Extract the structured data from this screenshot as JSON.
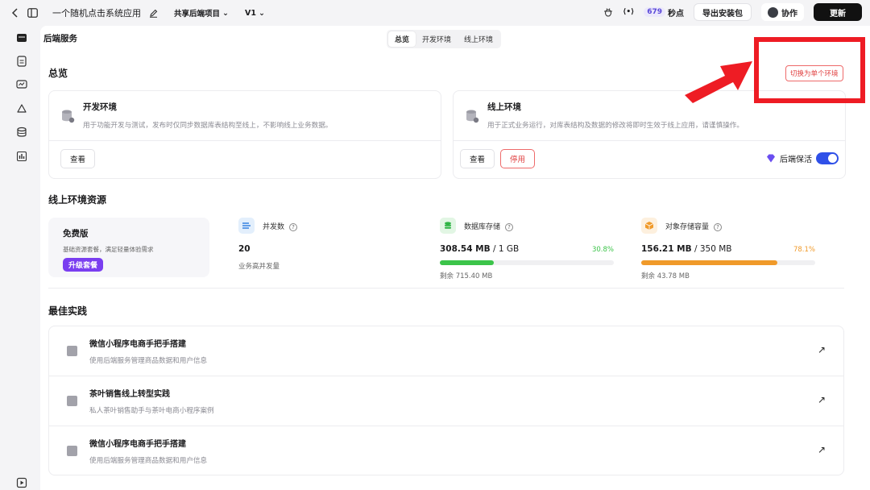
{
  "topbar": {
    "app_name": "一个随机点击系统应用",
    "project": "共享后端项目",
    "version": "V1",
    "points_count": "679",
    "points_label": "秒点",
    "export_label": "导出安装包",
    "collab_label": "协作",
    "update_label": "更新"
  },
  "header": {
    "title": "后端服务",
    "tabs": [
      "总览",
      "开发环境",
      "线上环境"
    ]
  },
  "overview": {
    "title": "总览",
    "switch_label": "切换为单个环境",
    "dev": {
      "name": "开发环境",
      "desc": "用于功能开发与测试，发布时仅同步数据库表结构至线上，不影响线上业务数据。",
      "view_label": "查看"
    },
    "prod": {
      "name": "线上环境",
      "desc": "用于正式业务运行，对库表结构及数据的修改将即时生效于线上应用，请谨慎操作。",
      "view_label": "查看",
      "stop_label": "停用",
      "keepalive_label": "后端保活",
      "keepalive_on": true
    }
  },
  "resources": {
    "title": "线上环境资源",
    "plan": {
      "name": "免费版",
      "desc": "基础资源套餐，满足轻量体验需求",
      "upgrade_label": "升级套餐"
    },
    "concurrency": {
      "label": "并发数",
      "value": "20",
      "sub": "业务高并发量"
    },
    "db": {
      "label": "数据库存储",
      "used": "308.54 MB",
      "total": " / 1 GB",
      "percent": "30.8%",
      "fraction": 0.308,
      "remain": "剩余 715.40 MB",
      "color": "#3cc44a"
    },
    "obj": {
      "label": "对象存储容量",
      "used": "156.21 MB",
      "total": " / 350 MB",
      "percent": "78.1%",
      "fraction": 0.781,
      "remain": "剩余 43.78 MB",
      "color": "#f09a2a"
    }
  },
  "best_practices": {
    "title": "最佳实践",
    "items": [
      {
        "title": "微信小程序电商手把手搭建",
        "desc": "使用后端服务管理商品数据和用户信息"
      },
      {
        "title": "茶叶销售线上转型实践",
        "desc": "私人茶叶销售助手与茶叶电商小程序案例"
      },
      {
        "title": "微信小程序电商手把手搭建",
        "desc": "使用后端服务管理商品数据和用户信息"
      }
    ]
  }
}
